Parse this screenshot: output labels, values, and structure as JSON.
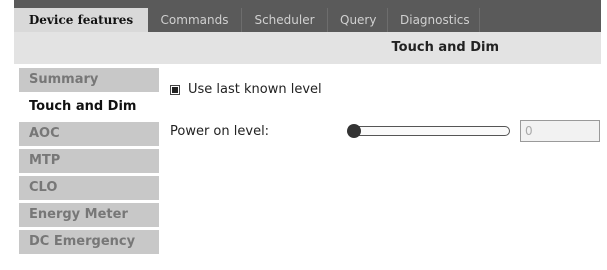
{
  "tabs": [
    {
      "label": "Device features",
      "active": true
    },
    {
      "label": "Commands",
      "active": false
    },
    {
      "label": "Scheduler",
      "active": false
    },
    {
      "label": "Query",
      "active": false
    },
    {
      "label": "Diagnostics",
      "active": false
    }
  ],
  "header": {
    "title": "Touch and Dim"
  },
  "sidebar": {
    "items": [
      {
        "label": "Summary",
        "active": false
      },
      {
        "label": "Touch and Dim",
        "active": true
      },
      {
        "label": "AOC",
        "active": false
      },
      {
        "label": "MTP",
        "active": false
      },
      {
        "label": "CLO",
        "active": false
      },
      {
        "label": "Energy Meter",
        "active": false
      },
      {
        "label": "DC Emergency",
        "active": false
      }
    ]
  },
  "main": {
    "use_last_known_level": {
      "label": "Use last known level",
      "checked": true
    },
    "power_on_level": {
      "label": "Power on level:",
      "slider_fraction": 0,
      "value": "0"
    }
  }
}
